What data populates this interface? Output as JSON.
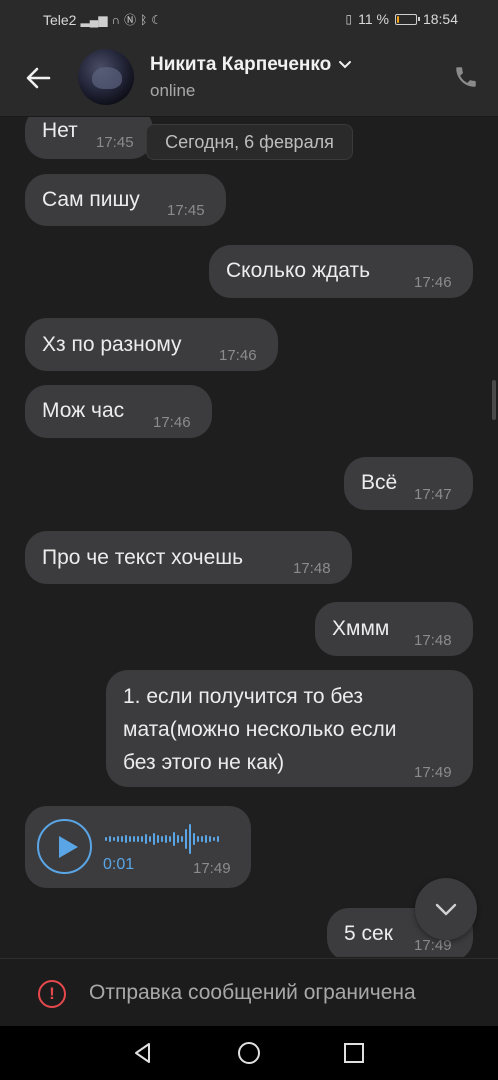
{
  "status_bar": {
    "carrier": "Tele2",
    "battery_text": "11 %",
    "battery_level": 0.11,
    "time": "18:54"
  },
  "header": {
    "contact_name": "Никита Карпеченко",
    "status": "online"
  },
  "date_separator": "Сегодня, 6 февраля",
  "messages": [
    {
      "side": "in",
      "text": "Нет",
      "time": "17:45"
    },
    {
      "side": "in",
      "text": "Сам пишу",
      "time": "17:45"
    },
    {
      "side": "out",
      "text": "Сколько ждать",
      "time": "17:46"
    },
    {
      "side": "in",
      "text": "Хз по разному",
      "time": "17:46"
    },
    {
      "side": "in",
      "text": "Мож час",
      "time": "17:46"
    },
    {
      "side": "out",
      "text": "Всё",
      "time": "17:47"
    },
    {
      "side": "in",
      "text": "Про че текст хочешь",
      "time": "17:48"
    },
    {
      "side": "out",
      "text": "Хммм",
      "time": "17:48"
    },
    {
      "side": "out",
      "lines": [
        "1. если получится то без",
        "мата(можно несколько если",
        "без этого не как)"
      ],
      "time": "17:49"
    },
    {
      "side": "in",
      "type": "voice",
      "duration": "0:01",
      "time": "17:49"
    },
    {
      "side": "out",
      "text": "5 сек",
      "time": "17:49"
    }
  ],
  "restricted_notice": "Отправка сообщений ограничена",
  "colors": {
    "background": "#1e1e1e",
    "bubble": "#3c3c3e",
    "accent": "#5aa5e6",
    "warning": "#e5484d"
  }
}
